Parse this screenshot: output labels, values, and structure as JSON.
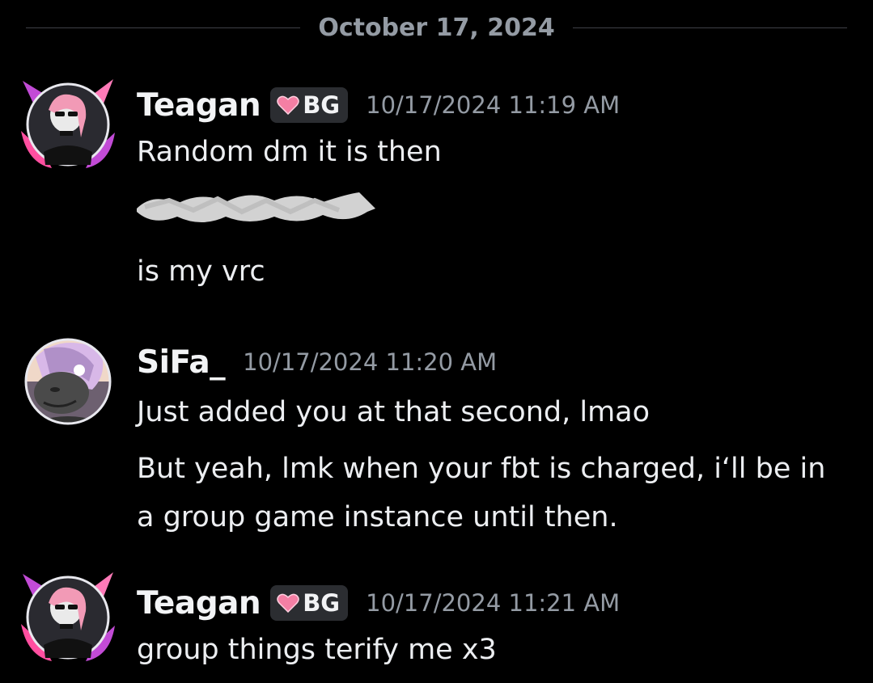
{
  "date_divider": "October 17, 2024",
  "colors": {
    "background": "#000000",
    "username": "#f2f3f5",
    "timestamp": "#949ba4",
    "message_text": "#eceef1",
    "tag_background": "#2b2d31",
    "heart": "#f47fa4"
  },
  "messages": [
    {
      "username": "Teagan",
      "tag": {
        "icon": "pink-heart-icon",
        "label": "BG"
      },
      "timestamp": "10/17/2024 11:19 AM",
      "avatar": "teagan-avatar",
      "lines": [
        "Random dm it is then",
        "is my vrc"
      ],
      "redacted": true
    },
    {
      "username": "SiFa_",
      "timestamp": "10/17/2024 11:20 AM",
      "avatar": "sifa-avatar",
      "lines": [
        "Just added you at that second, lmao",
        "But yeah, lmk when your fbt is charged, i‘ll be in",
        "a group game instance until then."
      ]
    },
    {
      "username": "Teagan",
      "tag": {
        "icon": "pink-heart-icon",
        "label": "BG"
      },
      "timestamp": "10/17/2024 11:21 AM",
      "avatar": "teagan-avatar",
      "lines": [
        "group things terify me x3"
      ]
    }
  ]
}
